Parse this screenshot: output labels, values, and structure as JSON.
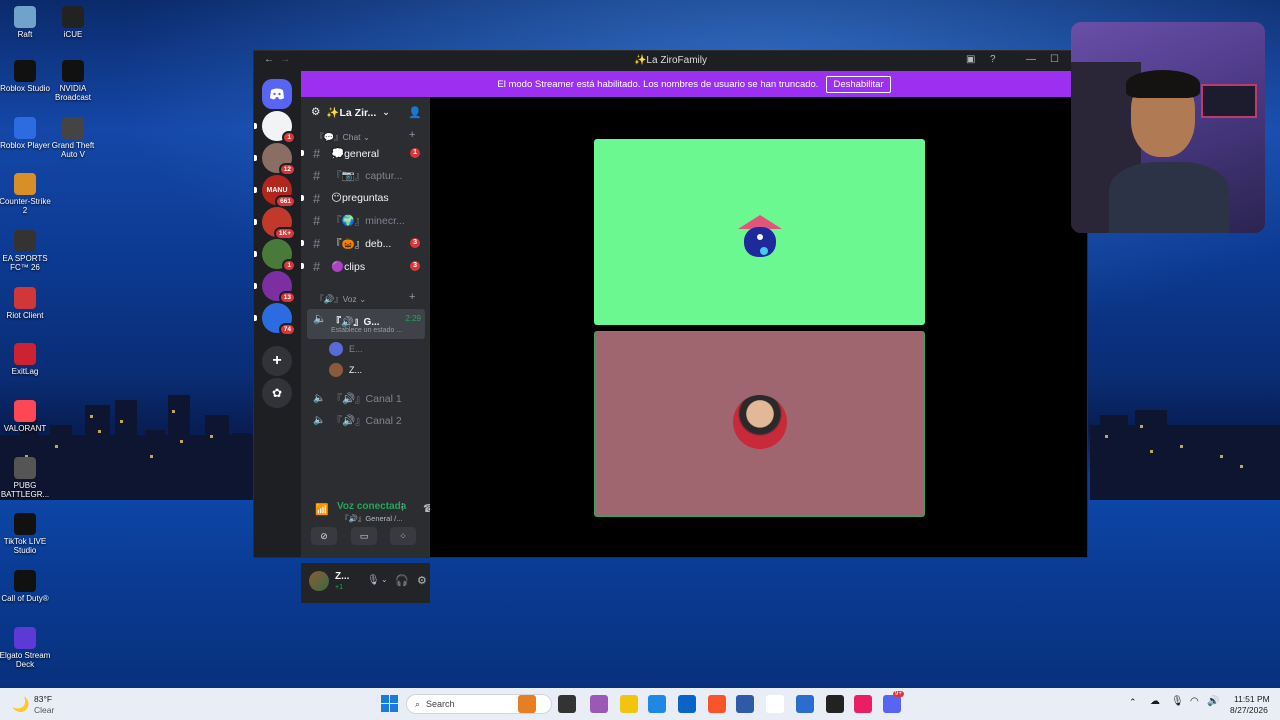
{
  "desktop": {
    "icons": [
      {
        "label": "Raft",
        "color": "#6fa3c9"
      },
      {
        "label": "iCUE",
        "color": "#222"
      },
      {
        "label": "Roblox Studio",
        "color": "#111"
      },
      {
        "label": "NVIDIA Broadcast",
        "color": "#111"
      },
      {
        "label": "Roblox Player",
        "color": "#2d6be0"
      },
      {
        "label": "Grand Theft Auto V",
        "color": "#444"
      },
      {
        "label": "Counter-Strike 2",
        "color": "#d88f27"
      },
      {
        "label": "EA SPORTS FC™ 26",
        "color": "#333"
      },
      {
        "label": "Riot Client",
        "color": "#d13639"
      },
      {
        "label": "ExitLag",
        "color": "#c23"
      },
      {
        "label": "VALORANT",
        "color": "#ff4655"
      },
      {
        "label": "PUBG BATTLEGR...",
        "color": "#555"
      },
      {
        "label": "TikTok LIVE Studio",
        "color": "#111"
      },
      {
        "label": "Call of Duty®",
        "color": "#111"
      },
      {
        "label": "Elgato Stream Deck",
        "color": "#5b3ad6"
      }
    ]
  },
  "discord": {
    "window_title": "✨La ZiroFamily",
    "banner": {
      "text": "El modo Streamer está habilitado. Los nombres de usuario se han truncado.",
      "button": "Deshabilitar"
    },
    "servers": [
      {
        "label": "",
        "badge": "1",
        "color": "#f2f3f5"
      },
      {
        "label": "",
        "badge": "12",
        "color": "#8a6d63"
      },
      {
        "label": "MANU",
        "badge": "661",
        "color": "#b3261e"
      },
      {
        "label": "",
        "badge": "1K+",
        "color": "#c0392b"
      },
      {
        "label": "",
        "badge": "1",
        "color": "#4a7a3a"
      },
      {
        "label": "",
        "badge": "13",
        "color": "#7b2fa0"
      },
      {
        "label": "",
        "badge": "74",
        "color": "#2d6be0"
      }
    ],
    "guild_name": "✨La Zir...",
    "category_chat": "『💬』Chat",
    "channels": [
      {
        "name": "💭general",
        "count": "1",
        "unread": true,
        "muted": false
      },
      {
        "name": "『📷』captur...",
        "count": "",
        "unread": false,
        "muted": true
      },
      {
        "name": "😶preguntas",
        "count": "",
        "unread": true,
        "muted": false
      },
      {
        "name": "『🌍』minecr...",
        "count": "",
        "unread": false,
        "muted": true
      },
      {
        "name": "『🎃』deb...",
        "count": "3",
        "unread": true,
        "muted": false
      },
      {
        "name": "🟣clips",
        "count": "3",
        "unread": true,
        "muted": false
      }
    ],
    "category_voice": "『🔊』Voz",
    "voice_channel_active": {
      "name": "『🔊』G...",
      "timer": "2:29",
      "status": "Establece un estado ..."
    },
    "voice_members": [
      "E...",
      "Z..."
    ],
    "voice_channels": [
      "『🔊』Canal 1",
      "『🔊』Canal 2"
    ],
    "voice_status": {
      "title": "Voz conectada",
      "sub": "『🔊』General /..."
    },
    "user": {
      "name": "Z...",
      "sub": "+1"
    }
  },
  "taskbar": {
    "weather_temp": "83°F",
    "weather_desc": "Clear",
    "search_placeholder": "Search",
    "time": "11:51 PM",
    "date": "8/27/2026",
    "discord_badge": "9+"
  },
  "colors": {
    "banner": "#9b30f0",
    "tile_top": "#6cf891",
    "tile_bottom": "#a06670",
    "voice_green": "#23a55a"
  }
}
